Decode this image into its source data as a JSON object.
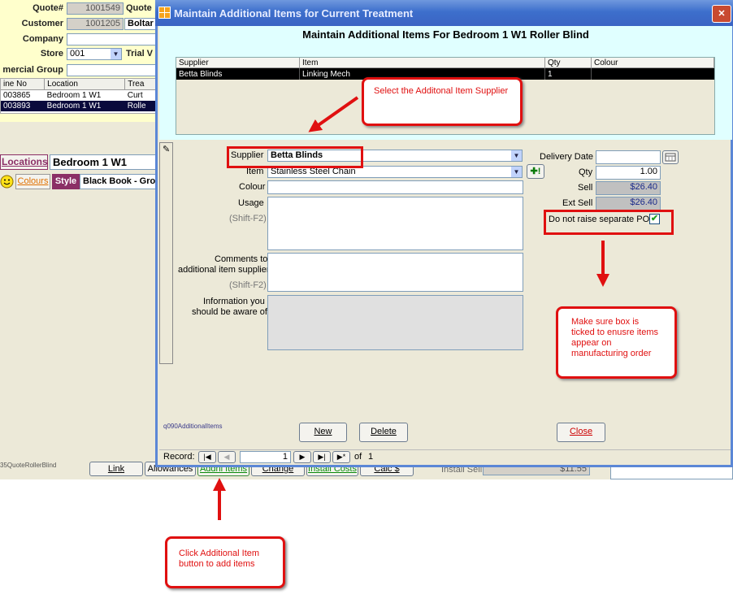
{
  "background": {
    "fields": {
      "quote_label": "Quote#",
      "quote_value": "1001549",
      "quote2_label": "Quote",
      "customer_label": "Customer",
      "customer_value": "1001205",
      "customer_name": "Boltar",
      "company_label": "Company",
      "store_label": "Store",
      "store_value": "001",
      "store_name": "Trial V",
      "commercial_group_label": "mercial Group"
    },
    "grid": {
      "headers": [
        "ine No",
        "Location",
        "Trea"
      ],
      "rows": [
        [
          "003865",
          "Bedroom 1 W1",
          "Curt"
        ],
        [
          "003893",
          "Bedroom 1 W1",
          "Rolle"
        ]
      ]
    },
    "locations_label": "Locations",
    "location_value": "Bedroom 1 W1",
    "colours_label": "Colours",
    "style_label": "Style",
    "style_value": "Black Book - Gro",
    "form_name": "35QuoteRollerBlind",
    "buttons": [
      "Link",
      "Allowances",
      "Addnl Items",
      "Change",
      "Install Costs",
      "Calc $"
    ],
    "install_sell_label": "Install Sell",
    "install_sell_value": "$11.55"
  },
  "dialog": {
    "title": "Maintain Additional Items for Current Treatment",
    "header": "Maintain Additional Items For Bedroom 1 W1 Roller Blind",
    "table": {
      "headers": [
        "Supplier",
        "Item",
        "Qty",
        "Colour"
      ],
      "rows": [
        [
          "Betta Blinds",
          "Linking Mech",
          "1",
          ""
        ]
      ]
    },
    "form": {
      "supplier_label": "Supplier",
      "supplier_value": "Betta Blinds",
      "item_label": "Item",
      "item_value": "Stainless Steel Chain",
      "colour_label": "Colour",
      "usage_label": "Usage",
      "usage_hint": "(Shift-F2)",
      "comments_label_1": "Comments to",
      "comments_label_2": "additional item supplier",
      "comments_hint": "(Shift-F2)",
      "info_label_1": "Information you",
      "info_label_2": "should be aware of",
      "delivery_date_label": "Delivery Date",
      "qty_label": "Qty",
      "qty_value": "1.00",
      "sell_label": "Sell",
      "sell_value": "$26.40",
      "ext_sell_label": "Ext Sell",
      "ext_sell_value": "$26.40",
      "no_po_label": "Do not raise separate PO",
      "no_po_checked": true
    },
    "form_name": "q090AdditionalItems",
    "buttons": {
      "new": "New",
      "delete": "Delete",
      "close": "Close"
    },
    "record_nav": {
      "label": "Record:",
      "current": "1",
      "of_label": "of",
      "total": "1"
    }
  },
  "annotations": {
    "supplier_callout": "Select the Additonal Item Supplier",
    "checkbox_callout": "Make sure box is ticked to enusre items appear on manufacturing order",
    "addnl_callout": "Click Additional Item button to add items"
  },
  "colors": {
    "annotation_red": "#e01010",
    "titlebar_blue": "#3d6fcc",
    "header_cyan": "#e0ffff",
    "form_beige": "#ece9d8"
  }
}
